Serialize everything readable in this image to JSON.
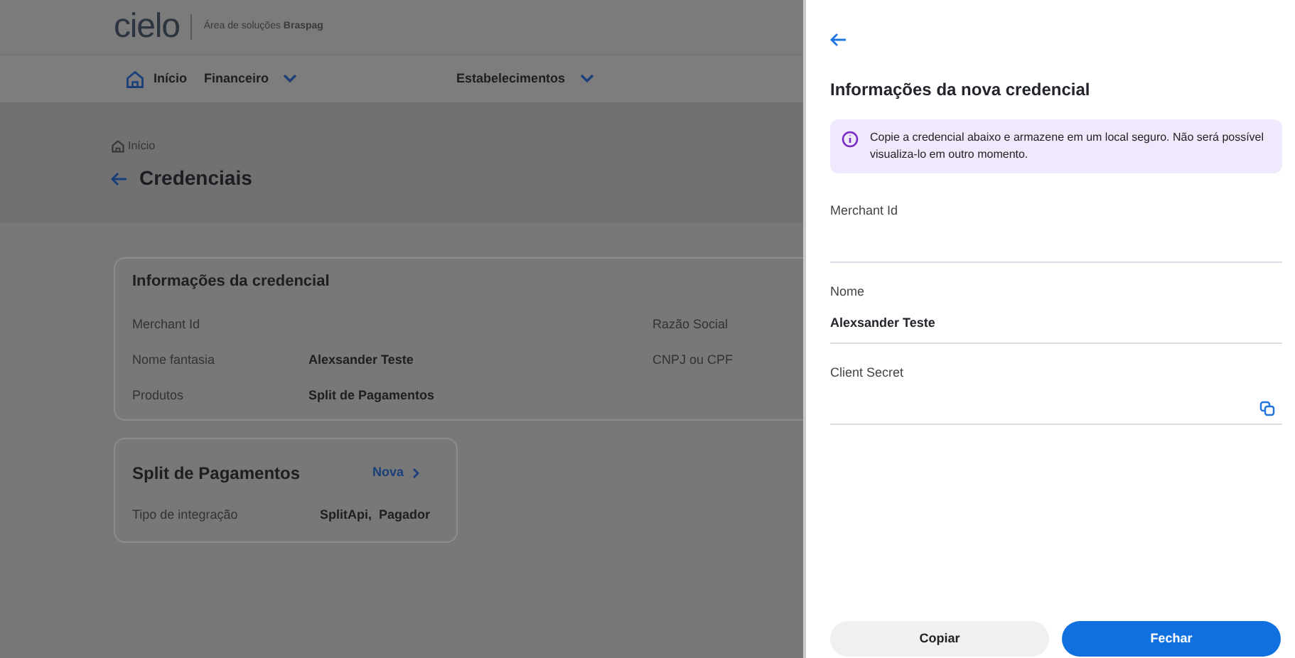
{
  "header": {
    "logo": "cielo",
    "subtitle": "Área de soluções **Braspag**"
  },
  "nav": [
    {
      "label": "Início",
      "kind": "home"
    },
    {
      "label": "Financeiro",
      "kind": "dropdown"
    },
    {
      "label": "Estabelecimentos",
      "kind": "dropdown"
    }
  ],
  "breadcrumb": "Início",
  "page_title": "Credenciais",
  "credential_card": {
    "title": "Informações da credencial",
    "rows": [
      {
        "label": "Merchant Id",
        "label_2": "Razão Social"
      },
      {
        "label": "Nome fantasia",
        "value": "Alexsander Teste",
        "label_2": "CNPJ ou CPF"
      },
      {
        "label": "Produtos",
        "value": "Split de Pagamentos"
      }
    ]
  },
  "product_card": {
    "title": "Split de Pagamentos",
    "link": "Nova",
    "label": "Tipo de integração",
    "value": "SplitApi,  Pagador"
  },
  "drawer": {
    "title": "Informações da nova credencial",
    "alert": "Copie a credencial abaixo e armazene em um local seguro. Não será possível visualiza-lo em outro momento.",
    "fields": [
      {
        "label": "Merchant Id",
        "copyable": false
      },
      {
        "label": "Nome",
        "value": "Alexsander Teste",
        "copyable": false
      },
      {
        "label": "Client Secret",
        "copyable": true
      }
    ],
    "buttons": [
      {
        "label": "Copiar",
        "kind": "secondary"
      },
      {
        "label": "Fechar",
        "kind": "primary"
      }
    ]
  }
}
